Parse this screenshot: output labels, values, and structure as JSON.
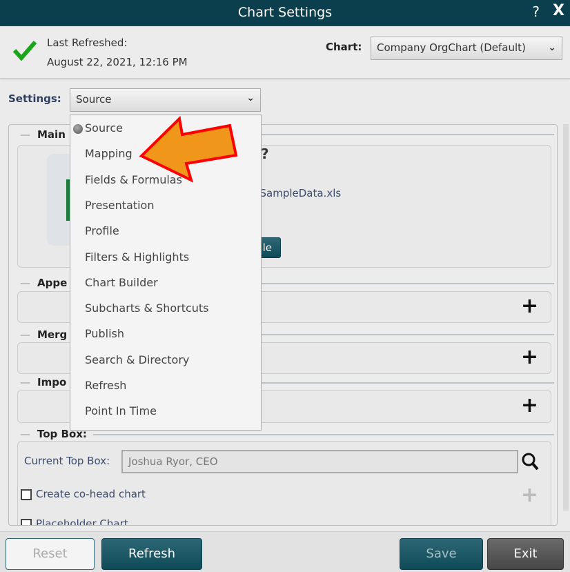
{
  "window": {
    "title": "Chart Settings",
    "help_icon": "?",
    "close_icon": "X"
  },
  "status": {
    "icon": "checkmark-icon",
    "label": "Last Refreshed:",
    "timestamp": "August 22, 2021, 12:16 PM"
  },
  "chart_select": {
    "label": "Chart:",
    "value": "Company OrgChart (Default)"
  },
  "settings_select": {
    "label": "Settings:",
    "value": "Source",
    "options": [
      "Source",
      "Mapping",
      "Fields & Formulas",
      "Presentation",
      "Profile",
      "Filters & Highlights",
      "Chart Builder",
      "Subcharts & Shortcuts",
      "Publish",
      "Search & Directory",
      "Refresh",
      "Point In Time"
    ]
  },
  "sections": {
    "main": {
      "title": "Main",
      "filename": "_SampleData.xls",
      "button_partial": "le",
      "partial_glyph": "?"
    },
    "append": {
      "title": "Appe"
    },
    "merge": {
      "title": "Merg"
    },
    "import": {
      "title": "Impo"
    },
    "topbox": {
      "title": "Top Box:",
      "current_label": "Current Top Box:",
      "current_value": "Joshua Ryor, CEO",
      "cohead_label": "Create co-head chart",
      "placeholder_label": "Placeholder Chart"
    }
  },
  "footer": {
    "reset": "Reset",
    "refresh": "Refresh",
    "save": "Save",
    "exit": "Exit"
  },
  "colors": {
    "titlebar": "#0c3f4d",
    "accent_teal": "#0f4a59",
    "check_green": "#1aa51a",
    "arrow_fill": "#f0961a",
    "arrow_stroke": "#ff0000"
  }
}
